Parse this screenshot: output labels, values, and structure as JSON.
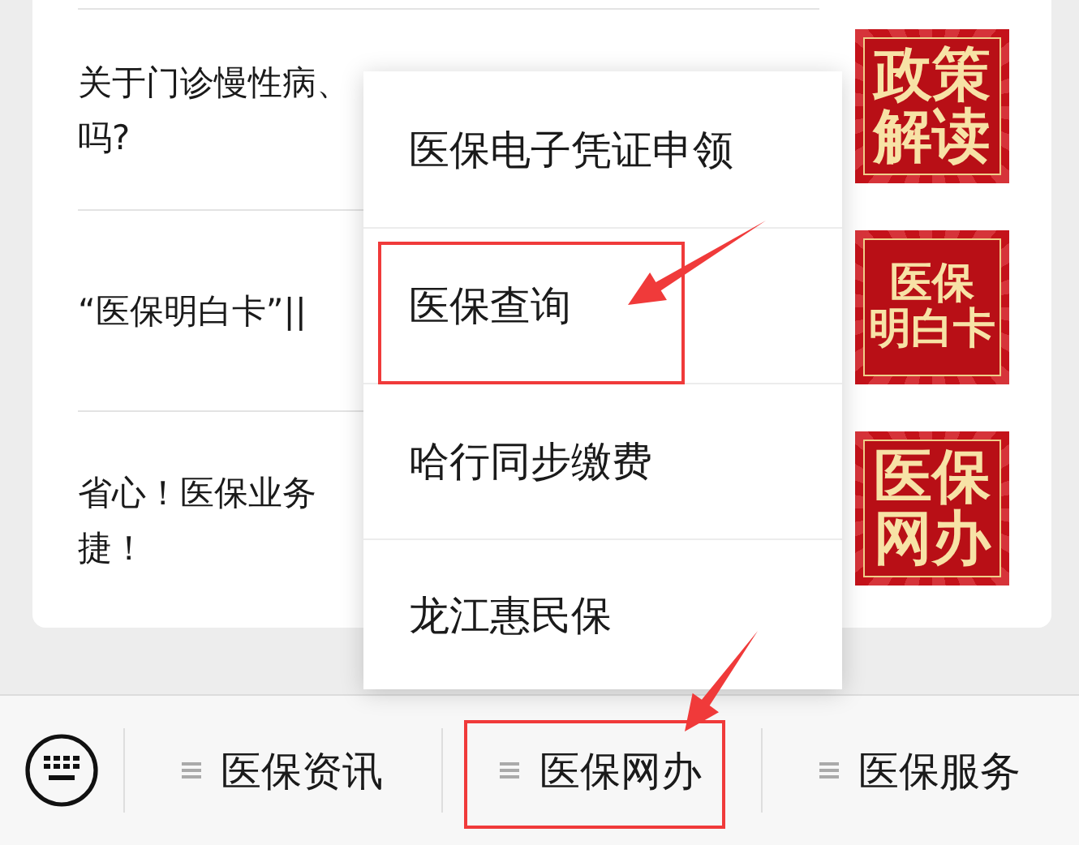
{
  "articles": [
    {
      "title_lines": [
        "关于门诊慢性病、",
        "吗?"
      ],
      "thumbnail_lines": [
        "政策",
        "解读"
      ]
    },
    {
      "title_lines": [
        "“医保明白卡”||"
      ],
      "thumbnail_lines": [
        "医保",
        "明白卡"
      ]
    },
    {
      "title_lines": [
        "省心！医保业务",
        "捷！"
      ],
      "thumbnail_lines": [
        "医保",
        "网办"
      ]
    }
  ],
  "popup_menu": [
    {
      "label": "医保电子凭证申领",
      "highlighted": false
    },
    {
      "label": "医保查询",
      "highlighted": true
    },
    {
      "label": "哈行同步缴费",
      "highlighted": false
    },
    {
      "label": "龙江惠民保",
      "highlighted": false
    }
  ],
  "menu_bar": [
    {
      "label": "医保资讯",
      "highlighted": false
    },
    {
      "label": "医保网办",
      "highlighted": true
    },
    {
      "label": "医保服务",
      "highlighted": false
    }
  ]
}
